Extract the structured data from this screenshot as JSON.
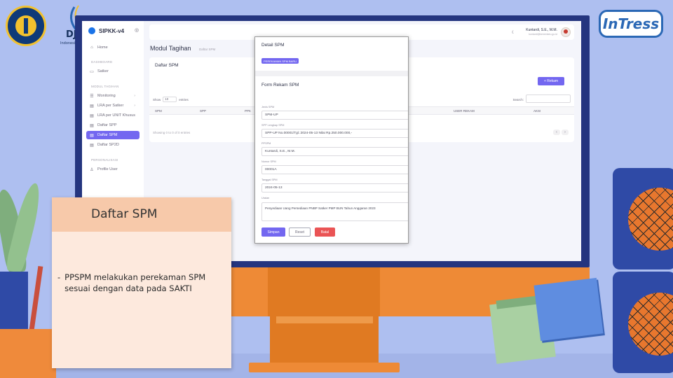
{
  "branding": {
    "djpb_text": "DJ",
    "djpb_sub": "Indonesia",
    "intress_text": "InTress"
  },
  "app": {
    "name": "SIPKK-v4",
    "toggle_icon": "circle-dot-icon"
  },
  "sidebar": {
    "sections": [
      {
        "label": "DASHBOARD"
      },
      {
        "label": "MODUL TAGIHAN"
      },
      {
        "label": "PERSONALISASI"
      }
    ],
    "items": [
      {
        "label": "Home",
        "icon": "home-icon"
      },
      {
        "label": "Satker",
        "icon": "monitor-icon"
      },
      {
        "label": "Monitoring",
        "icon": "list-icon",
        "chevron": "›"
      },
      {
        "label": "LRA per Satker",
        "icon": "doc-icon",
        "chevron": "›"
      },
      {
        "label": "LRA per UNIT Khusus",
        "icon": "doc-icon"
      },
      {
        "label": "Daftar SPP",
        "icon": "doc-icon"
      },
      {
        "label": "Daftar SPM",
        "icon": "doc-icon",
        "active": true
      },
      {
        "label": "Daftar SP2D",
        "icon": "doc-icon"
      },
      {
        "label": "Profile User",
        "icon": "user-icon"
      }
    ]
  },
  "topbar": {
    "user_name": "Kuntardi, S.E., M.M.",
    "user_email": "kuntardi@kemenkeu.go.id"
  },
  "page": {
    "title": "Modul Tagihan",
    "breadcrumb": "Daftar SPM"
  },
  "card": {
    "title": "Daftar SPM",
    "rekam_button": "+ Rekam",
    "show_label": "Show",
    "show_value": "10",
    "entries_label": "entries",
    "search_label": "Search:",
    "columns": [
      "SPM",
      "SPP",
      "PPK",
      "USER REKAM",
      "AKSI"
    ],
    "empty_info": "Showing 0 to 0 of 0 entries",
    "pager_prev": "‹",
    "pager_next": "›"
  },
  "modal": {
    "title": "Detail SPM",
    "badge": "PEREKAMAN SPM BARU",
    "form_title": "Form Rekam SPM",
    "fields": [
      {
        "label": "Jenis SPM",
        "value": "SPM-UP"
      },
      {
        "label": "SPP Lengkap SPM",
        "value": "SPP-UP No.00001/Tgl.:2024-05-13 Nilai Rp.250.000.000,-"
      },
      {
        "label": "PPSPM",
        "value": "Kuntardi, S.E., M.M."
      },
      {
        "label": "Nomor SPM",
        "value": "00001A"
      },
      {
        "label": "Tanggal SPM",
        "value": "2024-05-13"
      },
      {
        "label": "Uraian",
        "value": "Penyediaan Uang Persediaan PNBP Satker PMP BUN Tahun Anggaran 2023"
      }
    ],
    "buttons": {
      "save": "Simpan",
      "reset": "Reset",
      "cancel": "Batal"
    }
  },
  "caption": {
    "title": "Daftar SPM",
    "bullet_marker": "-",
    "bullet_text": "PPSPM melakukan perekaman SPM sesuai dengan data pada SAKTI"
  },
  "colors": {
    "accent": "#7367f0",
    "danger": "#ea5455",
    "monitor": "#24357f",
    "stand": "#e07a22"
  }
}
